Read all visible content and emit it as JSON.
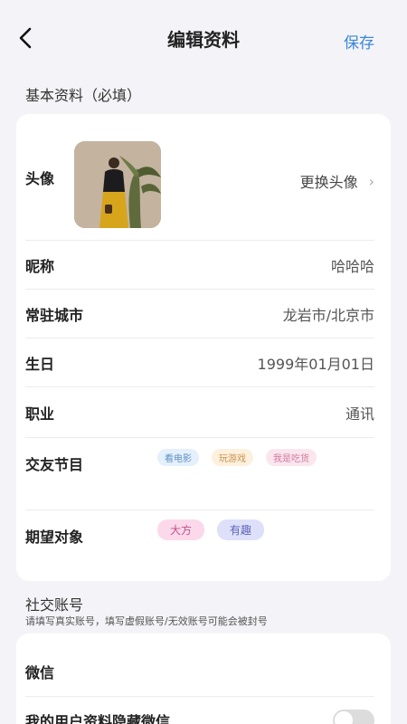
{
  "nav": {
    "title": "编辑资料",
    "save_label": "保存",
    "back_icon": "chevron-left-icon"
  },
  "basic_section": {
    "title": "基本资料（必填）",
    "avatar_label": "头像",
    "change_avatar_label": "更换头像",
    "nickname_label": "昵称",
    "nickname_value": "哈哈哈",
    "city_label": "常驻城市",
    "city_value": "龙岩市/北京市",
    "birthday_label": "生日",
    "birthday_value": "1999年01月01日",
    "job_label": "职业",
    "job_value": "通讯",
    "hobby_label": "交友节目",
    "hobby_tags": [
      "看电影",
      "玩游戏",
      "我是吃货"
    ],
    "expect_label": "期望对象",
    "expect_tags": [
      "大方",
      "有趣"
    ]
  },
  "social_section": {
    "title": "社交账号",
    "hint": "请填写真实账号，填写虚假账号/无效账号可能会被封号",
    "wechat_label": "微信",
    "hide_wechat_label": "我的用户资料隐藏微信",
    "hide_wechat_enabled": false
  },
  "colors": {
    "accent": "#3b86d9",
    "background": "#f4f4f8",
    "tag_movie": "#e4f0fb",
    "tag_game": "#fdf0dc",
    "tag_food": "#fbe6ee",
    "tag_generous": "#fbd9ea",
    "tag_fun": "#dde0f8"
  }
}
